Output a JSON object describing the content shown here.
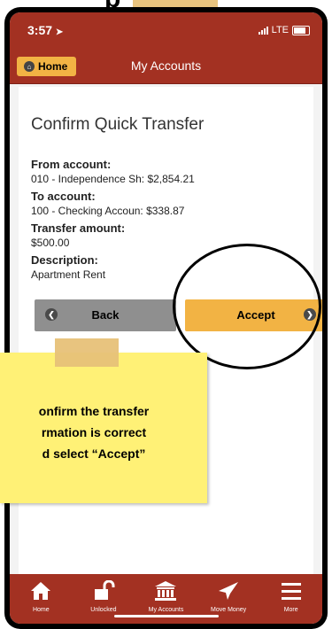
{
  "status_bar": {
    "time": "3:57",
    "network": "LTE"
  },
  "top_fragment": "p",
  "nav": {
    "home_label": "Home",
    "title": "My Accounts"
  },
  "confirm": {
    "title": "Confirm Quick Transfer",
    "from_label": "From account:",
    "from_value": "010 - Independence Sh: $2,854.21",
    "to_label": "To account:",
    "to_value": "100 - Checking Accoun: $338.87",
    "amount_label": "Transfer amount:",
    "amount_value": "$500.00",
    "description_label": "Description:",
    "description_value": "Apartment Rent"
  },
  "buttons": {
    "back": "Back",
    "accept": "Accept"
  },
  "tip": {
    "line1": "onfirm the transfer",
    "line2": "rmation is correct",
    "line3": "d select “Accept”"
  },
  "tab_bar": {
    "items": [
      {
        "label": "Home",
        "icon": "house-icon"
      },
      {
        "label": "Unlocked",
        "icon": "unlocked-padlock-icon"
      },
      {
        "label": "My Accounts",
        "icon": "bank-building-icon"
      },
      {
        "label": "Move Money",
        "icon": "paper-plane-icon"
      },
      {
        "label": "More",
        "icon": "hamburger-menu-icon"
      }
    ]
  },
  "colors": {
    "brand_red": "#a33122",
    "accent_yellow": "#f2b344",
    "back_gray": "#8f8f8f",
    "note_yellow": "#fff176",
    "tape_tan": "#e7c178"
  }
}
